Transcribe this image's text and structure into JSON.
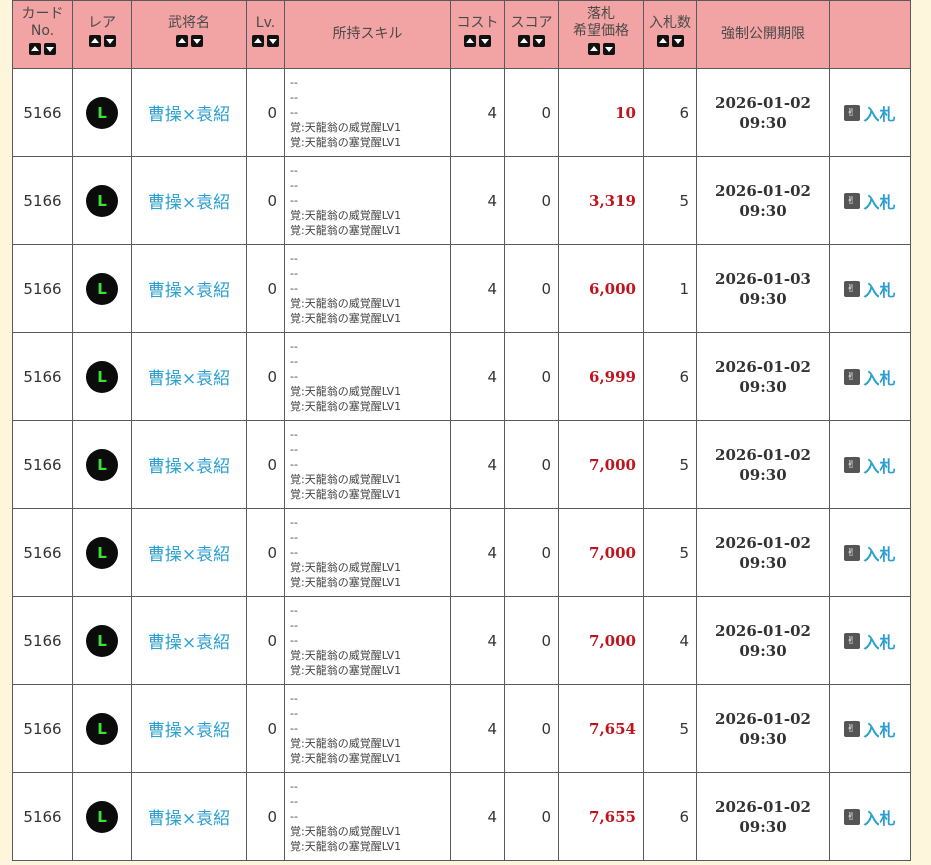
{
  "headers": {
    "card_no": [
      "カード",
      "No."
    ],
    "rarity": "レア",
    "name": "武将名",
    "lv": "Lv.",
    "skills": "所持スキル",
    "cost": "コスト",
    "score": "スコア",
    "price": [
      "落札",
      "希望価格"
    ],
    "bids": "入札数",
    "deadline": "強制公開期限"
  },
  "bid_label": "入札",
  "rows": [
    {
      "card_no": "5166",
      "rarity": "L",
      "name": "曹操×袁紹",
      "lv": "0",
      "skills": [
        "--",
        "--",
        "--",
        "覚:天龍翁の威覚醒LV1",
        "覚:天龍翁の塞覚醒LV1"
      ],
      "cost": "4",
      "score": "0",
      "price": "10",
      "bids": "6",
      "date": "2026-01-02",
      "time": "09:30"
    },
    {
      "card_no": "5166",
      "rarity": "L",
      "name": "曹操×袁紹",
      "lv": "0",
      "skills": [
        "--",
        "--",
        "--",
        "覚:天龍翁の威覚醒LV1",
        "覚:天龍翁の塞覚醒LV1"
      ],
      "cost": "4",
      "score": "0",
      "price": "3,319",
      "bids": "5",
      "date": "2026-01-02",
      "time": "09:30"
    },
    {
      "card_no": "5166",
      "rarity": "L",
      "name": "曹操×袁紹",
      "lv": "0",
      "skills": [
        "--",
        "--",
        "--",
        "覚:天龍翁の威覚醒LV1",
        "覚:天龍翁の塞覚醒LV1"
      ],
      "cost": "4",
      "score": "0",
      "price": "6,000",
      "bids": "1",
      "date": "2026-01-03",
      "time": "09:30"
    },
    {
      "card_no": "5166",
      "rarity": "L",
      "name": "曹操×袁紹",
      "lv": "0",
      "skills": [
        "--",
        "--",
        "--",
        "覚:天龍翁の威覚醒LV1",
        "覚:天龍翁の塞覚醒LV1"
      ],
      "cost": "4",
      "score": "0",
      "price": "6,999",
      "bids": "6",
      "date": "2026-01-02",
      "time": "09:30"
    },
    {
      "card_no": "5166",
      "rarity": "L",
      "name": "曹操×袁紹",
      "lv": "0",
      "skills": [
        "--",
        "--",
        "--",
        "覚:天龍翁の威覚醒LV1",
        "覚:天龍翁の塞覚醒LV1"
      ],
      "cost": "4",
      "score": "0",
      "price": "7,000",
      "bids": "5",
      "date": "2026-01-02",
      "time": "09:30"
    },
    {
      "card_no": "5166",
      "rarity": "L",
      "name": "曹操×袁紹",
      "lv": "0",
      "skills": [
        "--",
        "--",
        "--",
        "覚:天龍翁の威覚醒LV1",
        "覚:天龍翁の塞覚醒LV1"
      ],
      "cost": "4",
      "score": "0",
      "price": "7,000",
      "bids": "5",
      "date": "2026-01-02",
      "time": "09:30"
    },
    {
      "card_no": "5166",
      "rarity": "L",
      "name": "曹操×袁紹",
      "lv": "0",
      "skills": [
        "--",
        "--",
        "--",
        "覚:天龍翁の威覚醒LV1",
        "覚:天龍翁の塞覚醒LV1"
      ],
      "cost": "4",
      "score": "0",
      "price": "7,000",
      "bids": "4",
      "date": "2026-01-02",
      "time": "09:30"
    },
    {
      "card_no": "5166",
      "rarity": "L",
      "name": "曹操×袁紹",
      "lv": "0",
      "skills": [
        "--",
        "--",
        "--",
        "覚:天龍翁の威覚醒LV1",
        "覚:天龍翁の塞覚醒LV1"
      ],
      "cost": "4",
      "score": "0",
      "price": "7,654",
      "bids": "5",
      "date": "2026-01-02",
      "time": "09:30"
    },
    {
      "card_no": "5166",
      "rarity": "L",
      "name": "曹操×袁紹",
      "lv": "0",
      "skills": [
        "--",
        "--",
        "--",
        "覚:天龍翁の威覚醒LV1",
        "覚:天龍翁の塞覚醒LV1"
      ],
      "cost": "4",
      "score": "0",
      "price": "7,655",
      "bids": "6",
      "date": "2026-01-02",
      "time": "09:30"
    }
  ]
}
